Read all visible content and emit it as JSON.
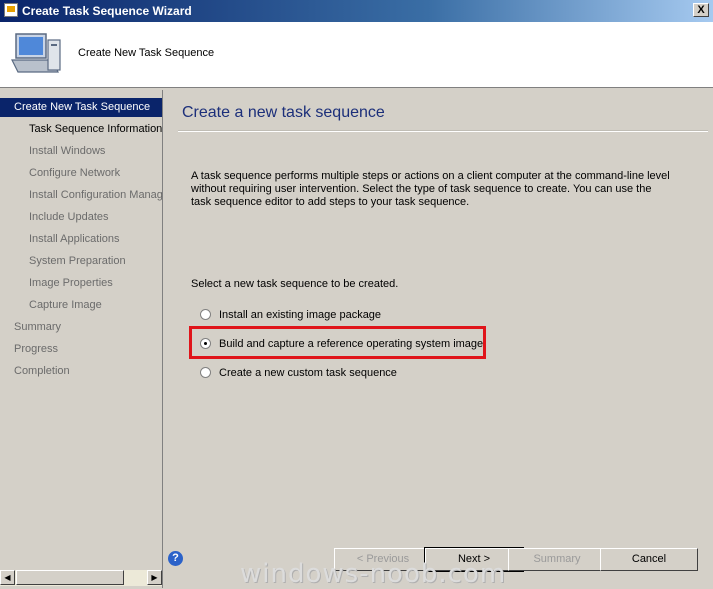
{
  "window": {
    "title": "Create Task Sequence Wizard",
    "close_label": "X"
  },
  "header": {
    "text": "Create New Task Sequence",
    "icon": "computer-monitor-icon"
  },
  "sidebar": {
    "items": [
      {
        "label": "Create New Task Sequence",
        "state": "active"
      },
      {
        "label": "Task Sequence Information",
        "state": "done"
      },
      {
        "label": "Install Windows",
        "state": "pending"
      },
      {
        "label": "Configure Network",
        "state": "pending"
      },
      {
        "label": "Install Configuration Manag",
        "state": "pending"
      },
      {
        "label": "Include Updates",
        "state": "pending"
      },
      {
        "label": "Install Applications",
        "state": "pending"
      },
      {
        "label": "System Preparation",
        "state": "pending"
      },
      {
        "label": "Image Properties",
        "state": "pending"
      },
      {
        "label": "Capture Image",
        "state": "pending"
      },
      {
        "label": "Summary",
        "state": "pending"
      },
      {
        "label": "Progress",
        "state": "pending"
      },
      {
        "label": "Completion",
        "state": "pending"
      }
    ]
  },
  "main": {
    "title": "Create a new task sequence",
    "description": "A task sequence performs multiple steps or actions on a client computer at the command-line level without requiring user intervention. Select the type of task sequence to create. You can use the task sequence editor to add steps to your task sequence.",
    "select_label": "Select a new task sequence to be created.",
    "options": [
      {
        "label": "Install an existing image package",
        "selected": false
      },
      {
        "label": "Build and capture a reference operating system image",
        "selected": true
      },
      {
        "label": "Create a new custom task sequence",
        "selected": false
      }
    ]
  },
  "buttons": {
    "previous": "< Previous",
    "next": "Next >",
    "summary": "Summary",
    "cancel": "Cancel"
  },
  "watermark": "windows-noob.com",
  "colors": {
    "highlight_box": "#e0141a",
    "active_nav": "#0a246a",
    "title_text": "#1c2f7a"
  }
}
